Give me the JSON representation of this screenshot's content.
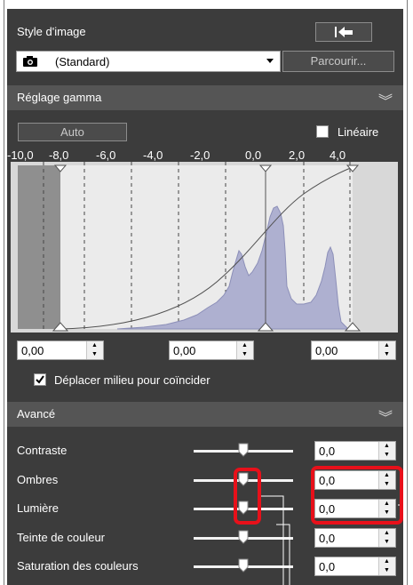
{
  "style_section": {
    "title": "Style d'image",
    "back_icon": "undo-arrow-icon",
    "selected_style": "(Standard)",
    "camera_icon": "camera-icon",
    "browse_label": "Parcourir..."
  },
  "gamma_section": {
    "title": "Réglage gamma",
    "collapse_icon": "double-chevron-down-icon",
    "auto_label": "Auto",
    "linear_label": "Linéaire",
    "linear_checked": false,
    "axis_ticks": [
      "-10,0",
      "-8,0",
      "-6,0",
      "-4,0",
      "-2,0",
      "0,0",
      "2,0",
      "4,0"
    ],
    "histogram_color": "#aeb0d0",
    "spin_left": "0,00",
    "spin_mid": "0,00",
    "spin_right": "0,00",
    "move_mid_label": "Déplacer milieu pour coïncider",
    "move_mid_checked": true
  },
  "advanced_section": {
    "title": "Avancé",
    "collapse_icon": "double-chevron-down-icon",
    "rows": [
      {
        "label": "Contraste",
        "value": "0,0",
        "level": 0.5
      },
      {
        "label": "Ombres",
        "value": "0,0",
        "level": 0.5
      },
      {
        "label": "Lumière",
        "value": "0,0",
        "level": 0.5
      },
      {
        "label": "Teinte de couleur",
        "value": "0,0",
        "level": 0.5
      },
      {
        "label": "Saturation des couleurs",
        "value": "0,0",
        "level": 0.5
      }
    ],
    "highlight_color": "#e8101a"
  }
}
